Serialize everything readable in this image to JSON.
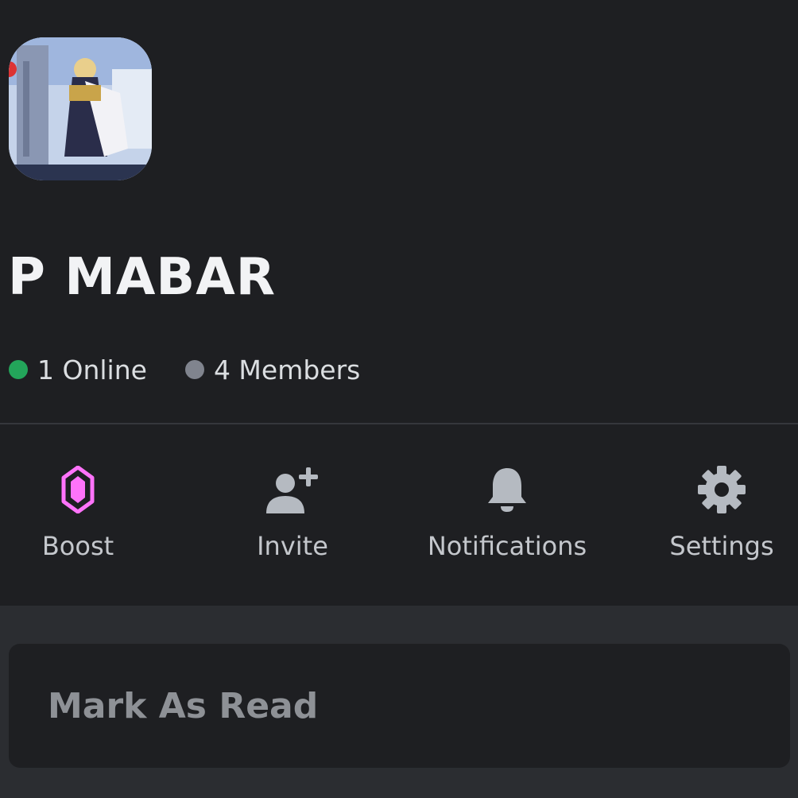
{
  "server": {
    "name": "P MABAR",
    "online": "1 Online",
    "members": "4 Members",
    "icon": "server-avatar-game-character"
  },
  "actions": [
    {
      "label": "Boost",
      "icon": "boost-gem-icon",
      "color": "#ff73fa"
    },
    {
      "label": "Invite",
      "icon": "add-person-icon",
      "color": "#b5bac1"
    },
    {
      "label": "Notifications",
      "icon": "bell-icon",
      "color": "#b5bac1"
    },
    {
      "label": "Settings",
      "icon": "gear-icon",
      "color": "#b5bac1"
    }
  ],
  "menu": {
    "mark_as_read": "Mark As Read"
  },
  "colors": {
    "background_top": "#1e1f22",
    "background_bottom": "#2b2d31",
    "online": "#23a55a",
    "offline": "#80848e"
  }
}
